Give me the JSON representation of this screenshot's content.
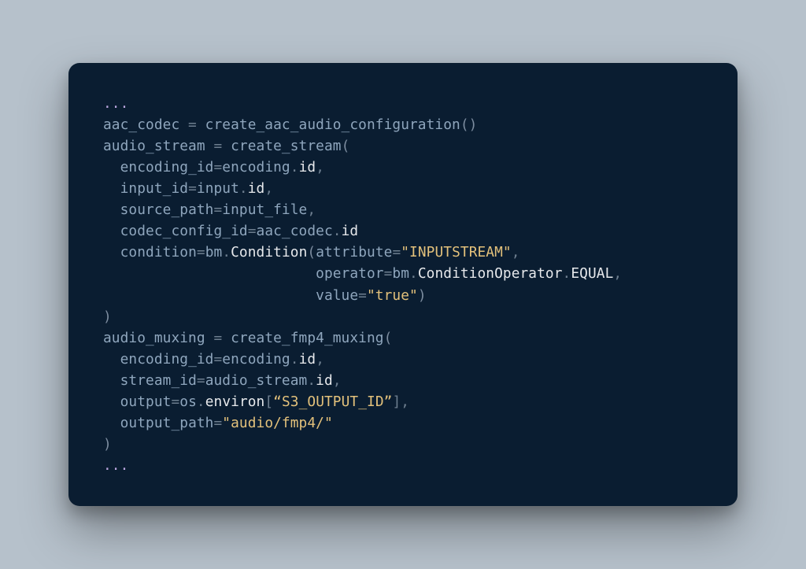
{
  "code": {
    "language": "python",
    "tokens": {
      "ellipsis": "...",
      "aac_codec": "aac_codec",
      "eq": " = ",
      "create_aac_audio_configuration": "create_aac_audio_configuration",
      "lp": "(",
      "rp": ")",
      "audio_stream": "audio_stream",
      "create_stream": "create_stream",
      "encoding_id": "encoding_id",
      "encoding": "encoding",
      "dot": ".",
      "id": "id",
      "comma": ",",
      "input_id": "input_id",
      "input": "input",
      "source_path": "source_path",
      "input_file": "input_file",
      "codec_config_id": "codec_config_id",
      "condition": "condition",
      "bm": "bm",
      "Condition": "Condition",
      "attribute": "attribute",
      "str_INPUTSTREAM": "\"INPUTSTREAM\"",
      "operator": "operator",
      "ConditionOperator": "ConditionOperator",
      "EQUAL": "EQUAL",
      "value": "value",
      "str_true": "\"true\"",
      "audio_muxing": "audio_muxing",
      "create_fmp4_muxing": "create_fmp4_muxing",
      "stream_id": "stream_id",
      "output": "output",
      "os": "os",
      "environ": "environ",
      "lb": "[",
      "rb": "]",
      "str_S3": "“S3_OUTPUT_ID”",
      "output_path": "output_path",
      "str_audio_fmp4": "\"audio/fmp4/\""
    }
  }
}
